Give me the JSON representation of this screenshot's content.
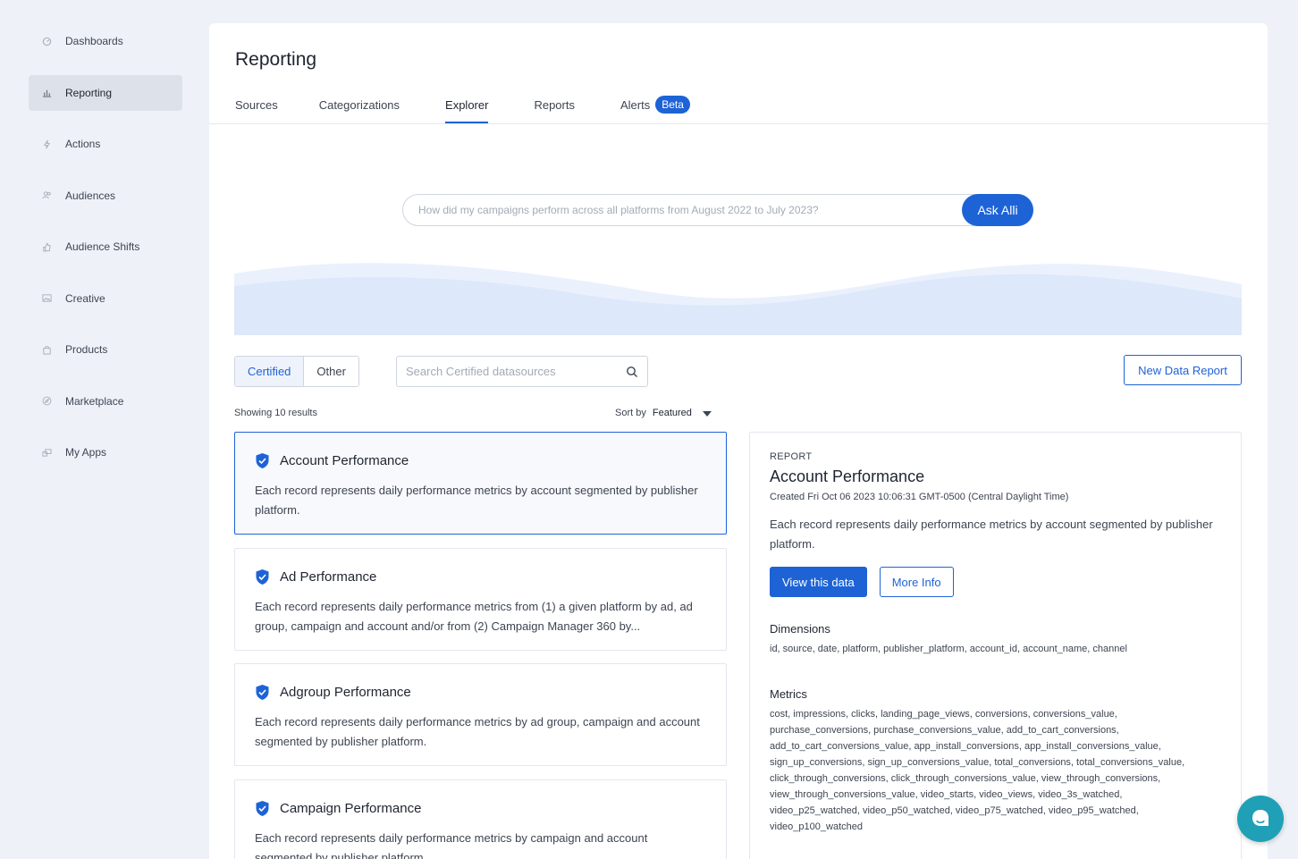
{
  "sidebar": {
    "items": [
      {
        "label": "Dashboards",
        "icon": "dashboard-icon"
      },
      {
        "label": "Reporting",
        "icon": "bar-chart-icon"
      },
      {
        "label": "Actions",
        "icon": "bolt-icon"
      },
      {
        "label": "Audiences",
        "icon": "people-icon"
      },
      {
        "label": "Audience Shifts",
        "icon": "thumb-icon"
      },
      {
        "label": "Creative",
        "icon": "image-icon"
      },
      {
        "label": "Products",
        "icon": "bag-icon"
      },
      {
        "label": "Marketplace",
        "icon": "compass-icon"
      },
      {
        "label": "My Apps",
        "icon": "apps-icon"
      }
    ],
    "active": "Reporting"
  },
  "header": {
    "title": "Reporting",
    "tabs": [
      {
        "label": "Sources"
      },
      {
        "label": "Categorizations"
      },
      {
        "label": "Explorer"
      },
      {
        "label": "Reports"
      },
      {
        "label": "Alerts",
        "badge": "Beta"
      }
    ],
    "active_tab": "Explorer"
  },
  "ask": {
    "placeholder": "How did my campaigns perform across all platforms from August 2022 to July 2023?",
    "button": "Ask Alli"
  },
  "filters": {
    "segments": [
      "Certified",
      "Other"
    ],
    "active_segment": "Certified",
    "search_placeholder": "Search Certified datasources",
    "new_button": "New Data Report"
  },
  "list": {
    "results_text": "Showing 10 results",
    "sort_label": "Sort by",
    "sort_value": "Featured",
    "items": [
      {
        "title": "Account Performance",
        "desc": "Each record represents daily performance metrics by account segmented by publisher platform."
      },
      {
        "title": "Ad Performance",
        "desc": "Each record represents daily performance metrics from (1) a given platform by ad, ad group, campaign and account and/or from (2) Campaign Manager 360 by..."
      },
      {
        "title": "Adgroup Performance",
        "desc": "Each record represents daily performance metrics by ad group, campaign and account segmented by publisher platform."
      },
      {
        "title": "Campaign Performance",
        "desc": "Each record represents daily performance metrics by campaign and account segmented by publisher platform."
      }
    ]
  },
  "detail": {
    "eyebrow": "REPORT",
    "title": "Account Performance",
    "created": "Created Fri Oct 06 2023 10:06:31 GMT-0500 (Central Daylight Time)",
    "desc": "Each record represents daily performance metrics by account segmented by publisher platform.",
    "view_button": "View this data",
    "info_button": "More Info",
    "dimensions_heading": "Dimensions",
    "dimensions": "id, source, date, platform, publisher_platform, account_id, account_name, channel",
    "metrics_heading": "Metrics",
    "metrics_lines": [
      "cost, impressions, clicks, landing_page_views, conversions, conversions_value,",
      "purchase_conversions, purchase_conversions_value, add_to_cart_conversions,",
      "add_to_cart_conversions_value, app_install_conversions, app_install_conversions_value,",
      "sign_up_conversions, sign_up_conversions_value, total_conversions, total_conversions_value,",
      "click_through_conversions, click_through_conversions_value, view_through_conversions,",
      "view_through_conversions_value, video_starts, video_views, video_3s_watched,",
      "video_p25_watched, video_p50_watched, video_p75_watched, video_p95_watched,",
      "video_p100_watched"
    ]
  },
  "colors": {
    "accent": "#1e63d6",
    "chat": "#1fa0b6",
    "background": "#eef2f8"
  }
}
